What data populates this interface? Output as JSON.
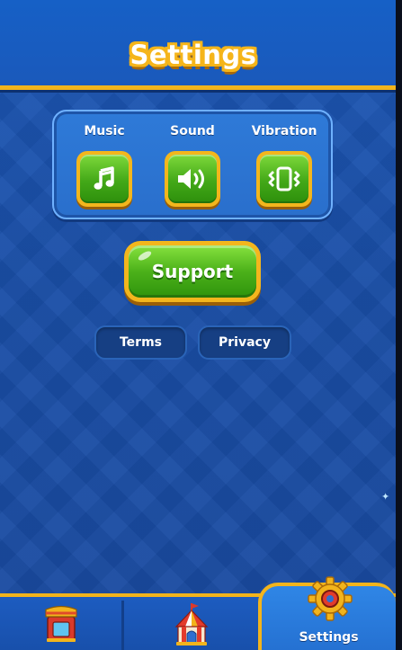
{
  "header": {
    "title": "Settings"
  },
  "toggles": [
    {
      "label": "Music",
      "icon": "music-note-icon"
    },
    {
      "label": "Sound",
      "icon": "speaker-icon"
    },
    {
      "label": "Vibration",
      "icon": "vibration-icon"
    }
  ],
  "support": {
    "label": "Support"
  },
  "links": {
    "terms": "Terms",
    "privacy": "Privacy"
  },
  "nav": {
    "tabs": [
      {
        "icon": "shop-icon"
      },
      {
        "icon": "circus-tent-icon"
      },
      {
        "icon": "gear-icon",
        "label": "Settings",
        "active": true
      }
    ]
  },
  "colors": {
    "background": "#1a4ea6",
    "accent_gold": "#f2b41c",
    "button_green": "#4cb11a",
    "dark_link": "#163f83"
  }
}
